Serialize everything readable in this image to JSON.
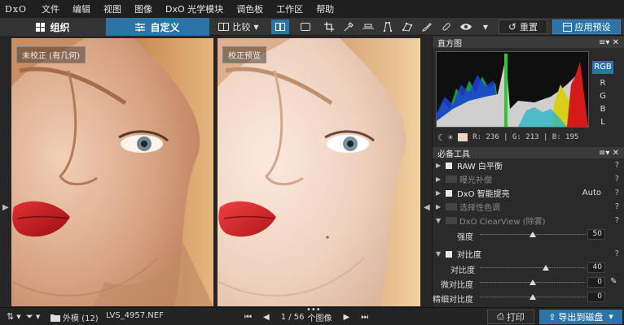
{
  "app": {
    "logo": "DxO"
  },
  "menu": [
    "文件",
    "编辑",
    "视图",
    "图像",
    "DxO 光学模块",
    "调色板",
    "工作区",
    "帮助"
  ],
  "tabs": {
    "organize": "组织",
    "customize": "自定义"
  },
  "toolbar": {
    "compare": "比较",
    "reset": "重置",
    "apply_preset": "应用预设"
  },
  "viewer": {
    "left_label": "未校正 (有几何)",
    "right_label": "校正预览"
  },
  "histogram": {
    "title": "直方图",
    "channels": [
      "RGB",
      "R",
      "G",
      "B",
      "L"
    ],
    "active_channel": "RGB",
    "readout": "R: 236  |  G: 213  |  B: 195",
    "swatch_color": "#ecd5c3"
  },
  "tools": {
    "title": "必备工具",
    "rows": [
      {
        "label": "RAW 白平衡",
        "enabled": true,
        "value": ""
      },
      {
        "label": "曝光补偿",
        "enabled": false,
        "value": ""
      },
      {
        "label": "DxO 智能提亮",
        "enabled": true,
        "value": "Auto"
      },
      {
        "label": "选择性色调",
        "enabled": false,
        "value": ""
      },
      {
        "label": "DxO ClearView (除雾)",
        "enabled": false,
        "value": ""
      }
    ],
    "strength": {
      "label": "强度",
      "value": "50",
      "level": 0.5
    },
    "contrast": {
      "label": "对比度",
      "sliders": [
        {
          "label": "对比度",
          "value": "40",
          "level": 0.62
        },
        {
          "label": "微对比度",
          "value": "0",
          "level": 0.5
        },
        {
          "label": "精细对比度",
          "value": "0",
          "level": 0.5
        }
      ]
    }
  },
  "bottom": {
    "folder": "外模 (12)",
    "filename": "LVS_4957.NEF",
    "counter": "1 / 56",
    "counter_suffix": "个图像",
    "print": "打印",
    "export": "导出到磁盘"
  }
}
